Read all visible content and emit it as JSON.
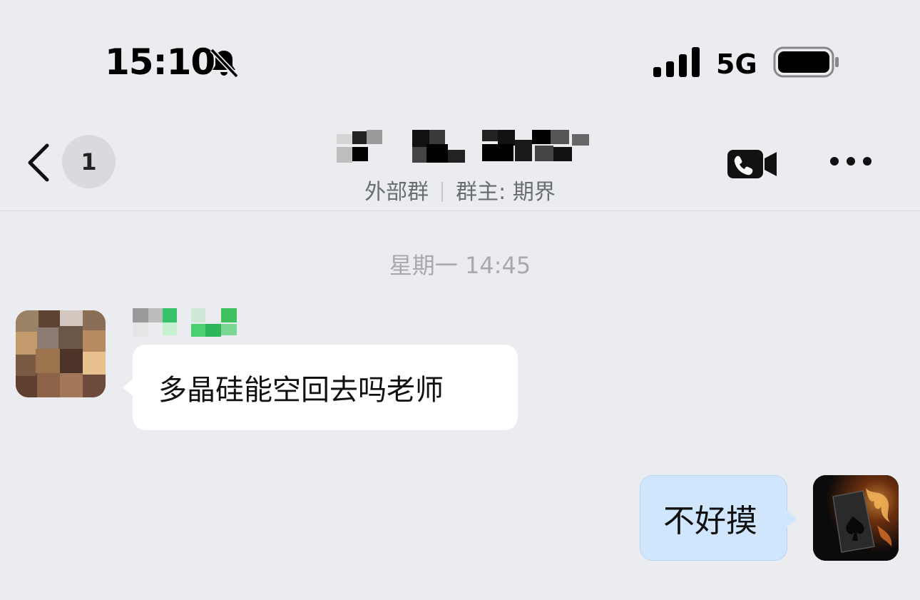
{
  "status_bar": {
    "time": "15:10",
    "network": "5G",
    "icons": [
      "bell-muted-icon",
      "signal-bars-icon",
      "battery-icon"
    ]
  },
  "header": {
    "back_icon": "chevron-left-icon",
    "unread_count": "1",
    "group_title": "",
    "subtitle_tag": "外部群",
    "subtitle_owner": "群主: 期界",
    "actions": [
      "video-call-icon",
      "more-icon"
    ]
  },
  "chat": {
    "timestamp": "星期一 14:45",
    "messages": [
      {
        "direction": "incoming",
        "sender": "",
        "text": "多晶硅能空回去吗老师"
      },
      {
        "direction": "outgoing",
        "text": "不好摸"
      }
    ]
  },
  "colors": {
    "background": "#ebecf0",
    "incoming_bubble": "#ffffff",
    "outgoing_bubble": "#cfe6fd",
    "badge": "#d9dade"
  }
}
